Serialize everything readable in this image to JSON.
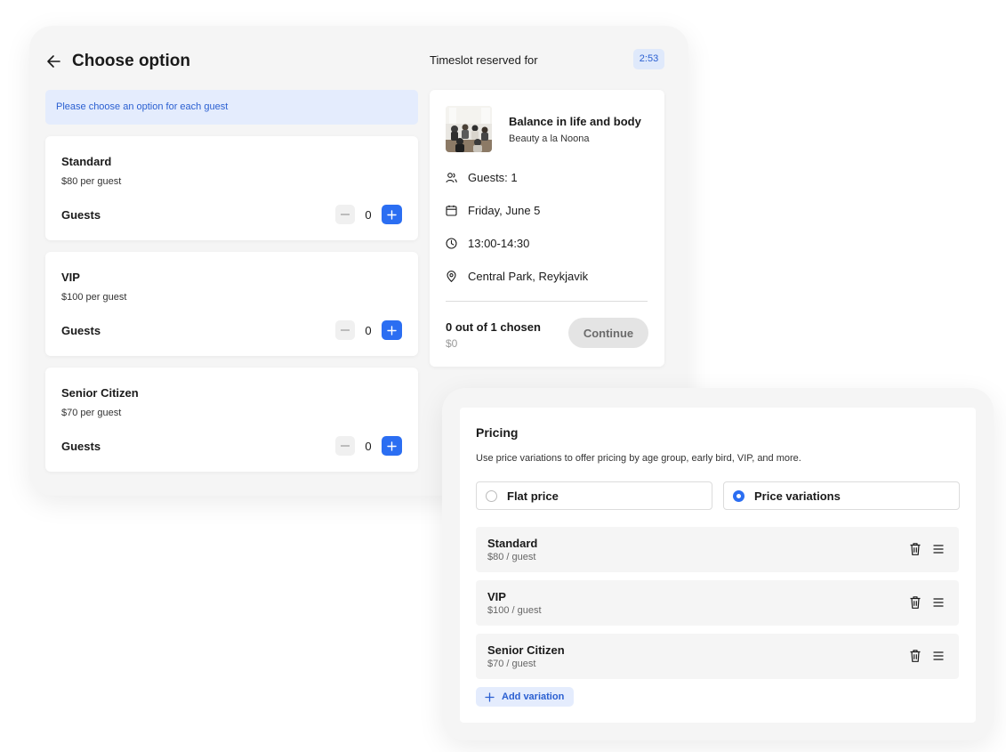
{
  "booking": {
    "title": "Choose option",
    "notice": "Please choose an option for each guest",
    "options": [
      {
        "name": "Standard",
        "price": "$80 per guest",
        "guests_label": "Guests",
        "count": "0"
      },
      {
        "name": "VIP",
        "price": "$100 per guest",
        "guests_label": "Guests",
        "count": "0"
      },
      {
        "name": "Senior Citizen",
        "price": "$70 per guest",
        "guests_label": "Guests",
        "count": "0"
      }
    ]
  },
  "timeslot": {
    "label": "Timeslot reserved for",
    "timer": "2:53"
  },
  "summary": {
    "event_title": "Balance in life and body",
    "organizer": "Beauty a la Noona",
    "guests": "Guests: 1",
    "date": "Friday, June 5",
    "time": "13:00-14:30",
    "location": "Central Park, Reykjavik",
    "chosen": "0 out of 1 chosen",
    "total": "$0",
    "continue_label": "Continue"
  },
  "pricing": {
    "title": "Pricing",
    "description": "Use price variations to offer pricing by age group, early bird, VIP, and more.",
    "flat_label": "Flat price",
    "variations_label": "Price variations",
    "selected_mode": "Price variations",
    "variations": [
      {
        "name": "Standard",
        "price": "$80 / guest"
      },
      {
        "name": "VIP",
        "price": "$100 / guest"
      },
      {
        "name": "Senior Citizen",
        "price": "$70 / guest"
      }
    ],
    "add_label": "Add variation"
  },
  "colors": {
    "accent": "#2b6ef2",
    "accent_soft": "#e4ecfd",
    "panel_bg": "#f5f5f5"
  }
}
